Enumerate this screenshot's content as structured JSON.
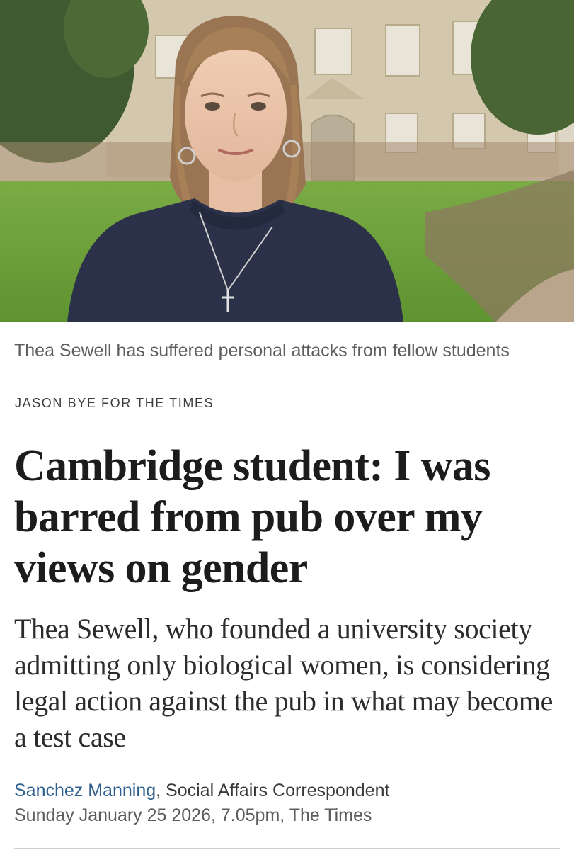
{
  "photo": {
    "description_icon": "article-hero-photo",
    "colors": {
      "sky": "#d9d4c6",
      "building": "#d2c7ae",
      "lawn": "#6fa13a",
      "sweater": "#2a3148",
      "hair": "#a88058"
    }
  },
  "caption": {
    "text": "Thea Sewell has suffered personal attacks from fellow students",
    "credit": "JASON BYE FOR THE TIMES"
  },
  "article": {
    "headline": "Cambridge student: I was barred from pub over my views on gender",
    "standfirst": "Thea Sewell, who founded a university society admitting only biological women, is considering legal action against the pub in what may become a test case"
  },
  "byline": {
    "author": "Sanchez Manning",
    "separator": ",",
    "role": " Social Affairs Correspondent",
    "date": "Sunday January 25 2026, 7.05pm, The Times"
  },
  "colors": {
    "author_link": "#2f5f8f",
    "text": "#1c1c1c",
    "muted": "#5d5d5d"
  }
}
